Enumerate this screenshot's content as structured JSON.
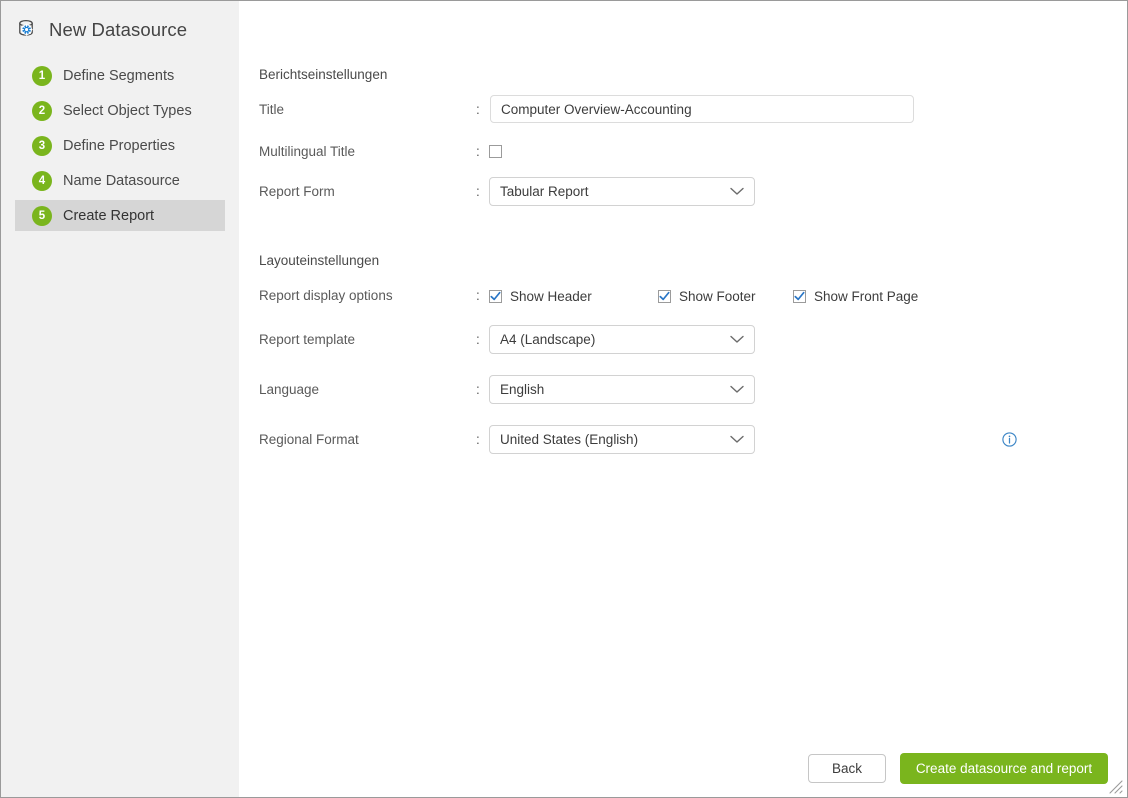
{
  "window": {
    "title": "New Datasource",
    "icon": "database-gear-icon",
    "expand_icon": "expand-diagonal-icon",
    "close_icon": "close-icon",
    "resize_grip": "resize-grip-icon"
  },
  "sidebar": {
    "steps": [
      {
        "number": "1",
        "label": "Define Segments",
        "active": false
      },
      {
        "number": "2",
        "label": "Select Object Types",
        "active": false
      },
      {
        "number": "3",
        "label": "Define Properties",
        "active": false
      },
      {
        "number": "4",
        "label": "Name Datasource",
        "active": false
      },
      {
        "number": "5",
        "label": "Create Report",
        "active": true
      }
    ]
  },
  "report_settings": {
    "section_title": "Berichtseinstellungen",
    "title": {
      "label": "Title",
      "separator": ":",
      "value": "Computer Overview-Accounting",
      "placeholder": "Title"
    },
    "multilingual_title": {
      "label": "Multilingual Title",
      "separator": ":",
      "checked": false
    },
    "report_form": {
      "label": "Report Form",
      "separator": ":",
      "value": "Tabular Report",
      "options": [
        "Tabular Report"
      ]
    }
  },
  "layout_settings": {
    "section_title": "Layouteinstellungen",
    "display_options": {
      "label": "Report display options",
      "separator": ":",
      "items": [
        {
          "label": "Show Header",
          "checked": true
        },
        {
          "label": "Show Footer",
          "checked": true
        },
        {
          "label": "Show Front Page",
          "checked": true
        }
      ]
    },
    "report_template": {
      "label": "Report template",
      "separator": ":",
      "value": "A4 (Landscape)",
      "options": [
        "A4 (Landscape)"
      ]
    },
    "language": {
      "label": "Language",
      "separator": ":",
      "value": "English",
      "options": [
        "English"
      ]
    },
    "regional_format": {
      "label": "Regional Format",
      "separator": ":",
      "value": "United States (English)",
      "options": [
        "United States (English)"
      ],
      "info_icon": "info-circle-icon"
    }
  },
  "footer": {
    "back_label": "Back",
    "create_label": "Create datasource and report"
  },
  "colors": {
    "accent_green": "#7ab51d",
    "checkbox_blue": "#2a76c6",
    "sidebar_bg": "#f1f1f1",
    "active_step_bg": "#d6d6d6",
    "info_blue": "#2a76c6"
  }
}
